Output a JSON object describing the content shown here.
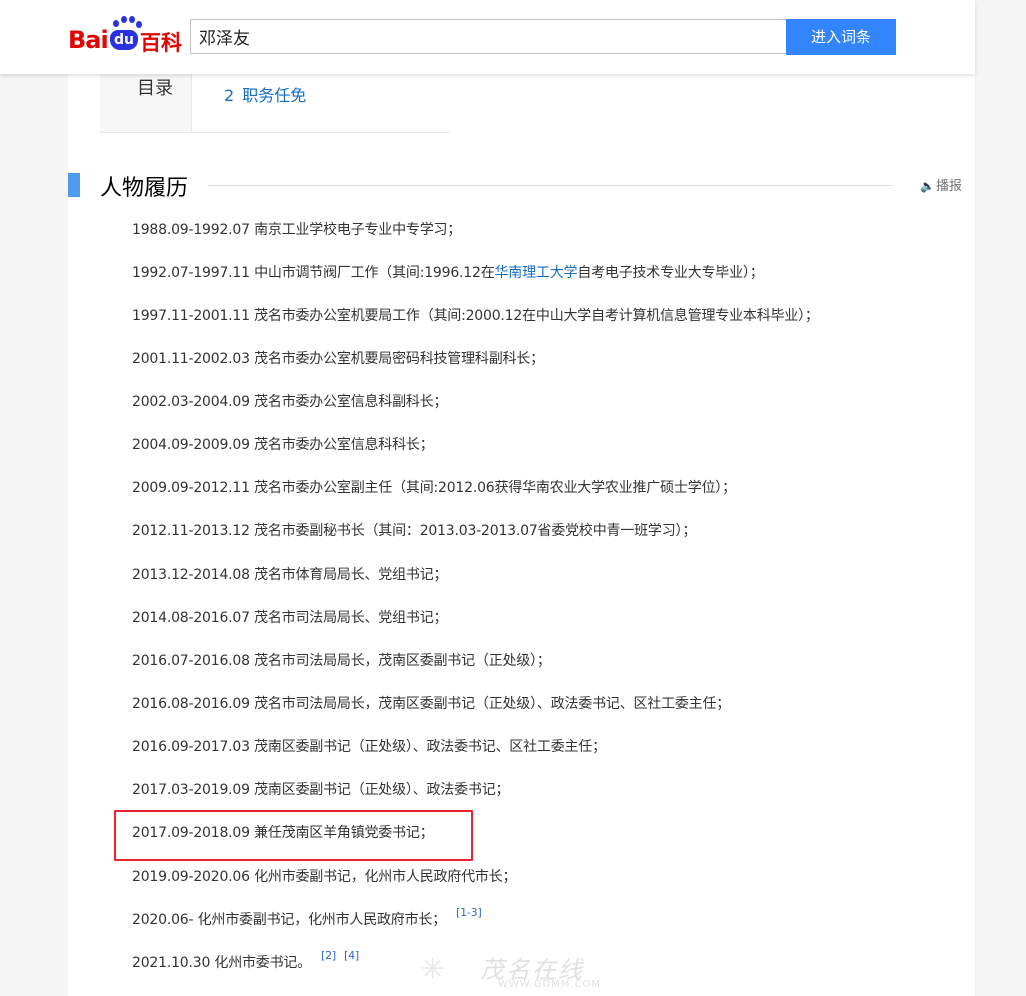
{
  "header": {
    "logo_bai": "Bai",
    "logo_du": "du",
    "logo_baike": "百科",
    "search_value": "邓泽友",
    "enter_button": "进入词条"
  },
  "catalog": {
    "label": "目录",
    "items": [
      {
        "num": "2",
        "text": "职务任免"
      }
    ]
  },
  "section": {
    "title": "人物履历",
    "play_label": "播报"
  },
  "resume": [
    {
      "text": "1988.09-1992.07 南京工业学校电子专业中专学习；"
    },
    {
      "pre": "1992.07-1997.11 中山市调节阀厂工作（其间:1996.12在",
      "link": "华南理工大学",
      "post": "自考电子技术专业大专毕业）；"
    },
    {
      "text": "1997.11-2001.11 茂名市委办公室机要局工作（其间:2000.12在中山大学自考计算机信息管理专业本科毕业）；"
    },
    {
      "text": "2001.11-2002.03 茂名市委办公室机要局密码科技管理科副科长；"
    },
    {
      "text": "2002.03-2004.09 茂名市委办公室信息科副科长；"
    },
    {
      "text": "2004.09-2009.09 茂名市委办公室信息科科长；"
    },
    {
      "text": "2009.09-2012.11 茂名市委办公室副主任（其间:2012.06获得华南农业大学农业推广硕士学位）；"
    },
    {
      "text": "2012.11-2013.12 茂名市委副秘书长（其间：2013.03-2013.07省委党校中青一班学习）；"
    },
    {
      "text": "2013.12-2014.08 茂名市体育局局长、党组书记；"
    },
    {
      "text": "2014.08-2016.07 茂名市司法局局长、党组书记；"
    },
    {
      "text": "2016.07-2016.08 茂名市司法局局长，茂南区委副书记（正处级）；"
    },
    {
      "text": "2016.08-2016.09 茂名市司法局局长，茂南区委副书记（正处级）、政法委书记、区社工委主任；"
    },
    {
      "text": "2016.09-2017.03 茂南区委副书记（正处级）、政法委书记、区社工委主任；"
    },
    {
      "text": "2017.03-2019.09 茂南区委副书记（正处级）、政法委书记；"
    },
    {
      "text": "2017.09-2018.09 兼任茂南区羊角镇党委书记；"
    },
    {
      "text": "2019.09-2020.06 化州市委副书记，化州市人民政府代市长；"
    },
    {
      "text": "2020.06- 化州市委副书记，化州市人民政府市长；",
      "refs": [
        "[1-3]"
      ]
    },
    {
      "text": "2021.10.30 化州市委书记。",
      "refs": [
        "[2]",
        "[4]"
      ]
    }
  ],
  "watermark": {
    "main": "茂名在线",
    "sub": "WWW.GDMM.COM"
  }
}
